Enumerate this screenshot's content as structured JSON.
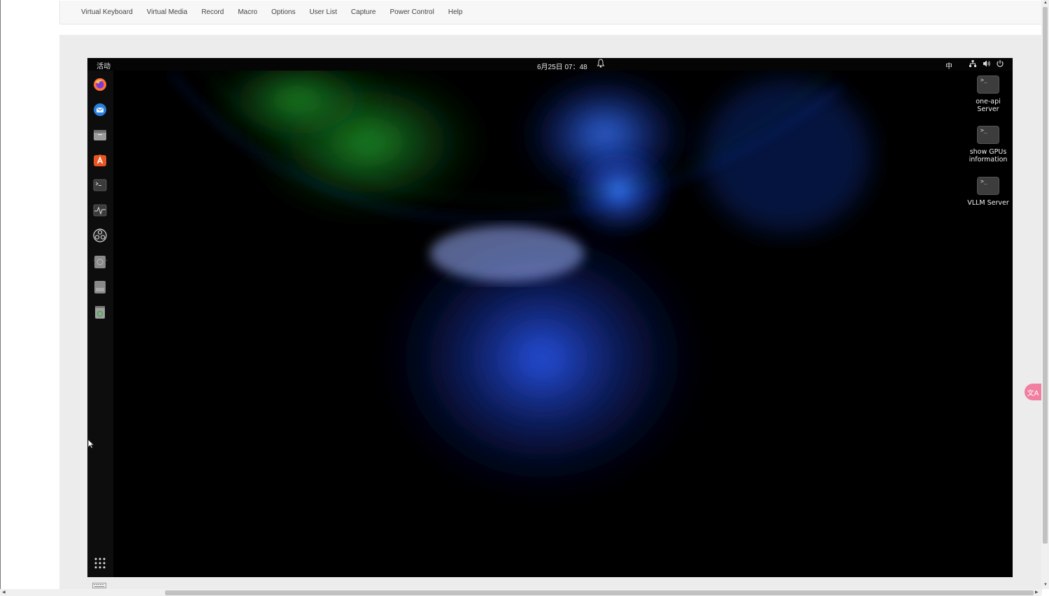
{
  "menu": [
    "Virtual Keyboard",
    "Virtual Media",
    "Record",
    "Macro",
    "Options",
    "User List",
    "Capture",
    "Power Control",
    "Help"
  ],
  "desktop": {
    "activities_label": "活动",
    "clock": "6月25日 07：48",
    "input_method": "中",
    "tray_icons": [
      "network-icon",
      "volume-icon",
      "power-icon"
    ],
    "dock": [
      {
        "name": "firefox-icon",
        "color": "#ff7139"
      },
      {
        "name": "thunderbird-icon",
        "color": "#2a7fdc"
      },
      {
        "name": "files-icon",
        "color": "#9c9c9c"
      },
      {
        "name": "app-center-icon",
        "color": "#e95420"
      },
      {
        "name": "terminal-icon",
        "color": "#3b3b3b"
      },
      {
        "name": "system-monitor-icon",
        "color": "#3b3b3b"
      },
      {
        "name": "obs-studio-icon",
        "color": "#1e1e1e"
      },
      {
        "name": "disk-drive-icon",
        "color": "#8a8a8a"
      },
      {
        "name": "ssd-drive-icon",
        "color": "#8a8a8a"
      },
      {
        "name": "trash-icon",
        "color": "#a0a0a0"
      }
    ],
    "show_apps_icon": "show-applications-icon",
    "desktop_icons": [
      {
        "label_line1": "one-api",
        "label_line2": "Server"
      },
      {
        "label_line1": "show GPUs",
        "label_line2": "information"
      },
      {
        "label_line1": "VLLM Server",
        "label_line2": ""
      }
    ]
  },
  "translate_button_label": "文A"
}
